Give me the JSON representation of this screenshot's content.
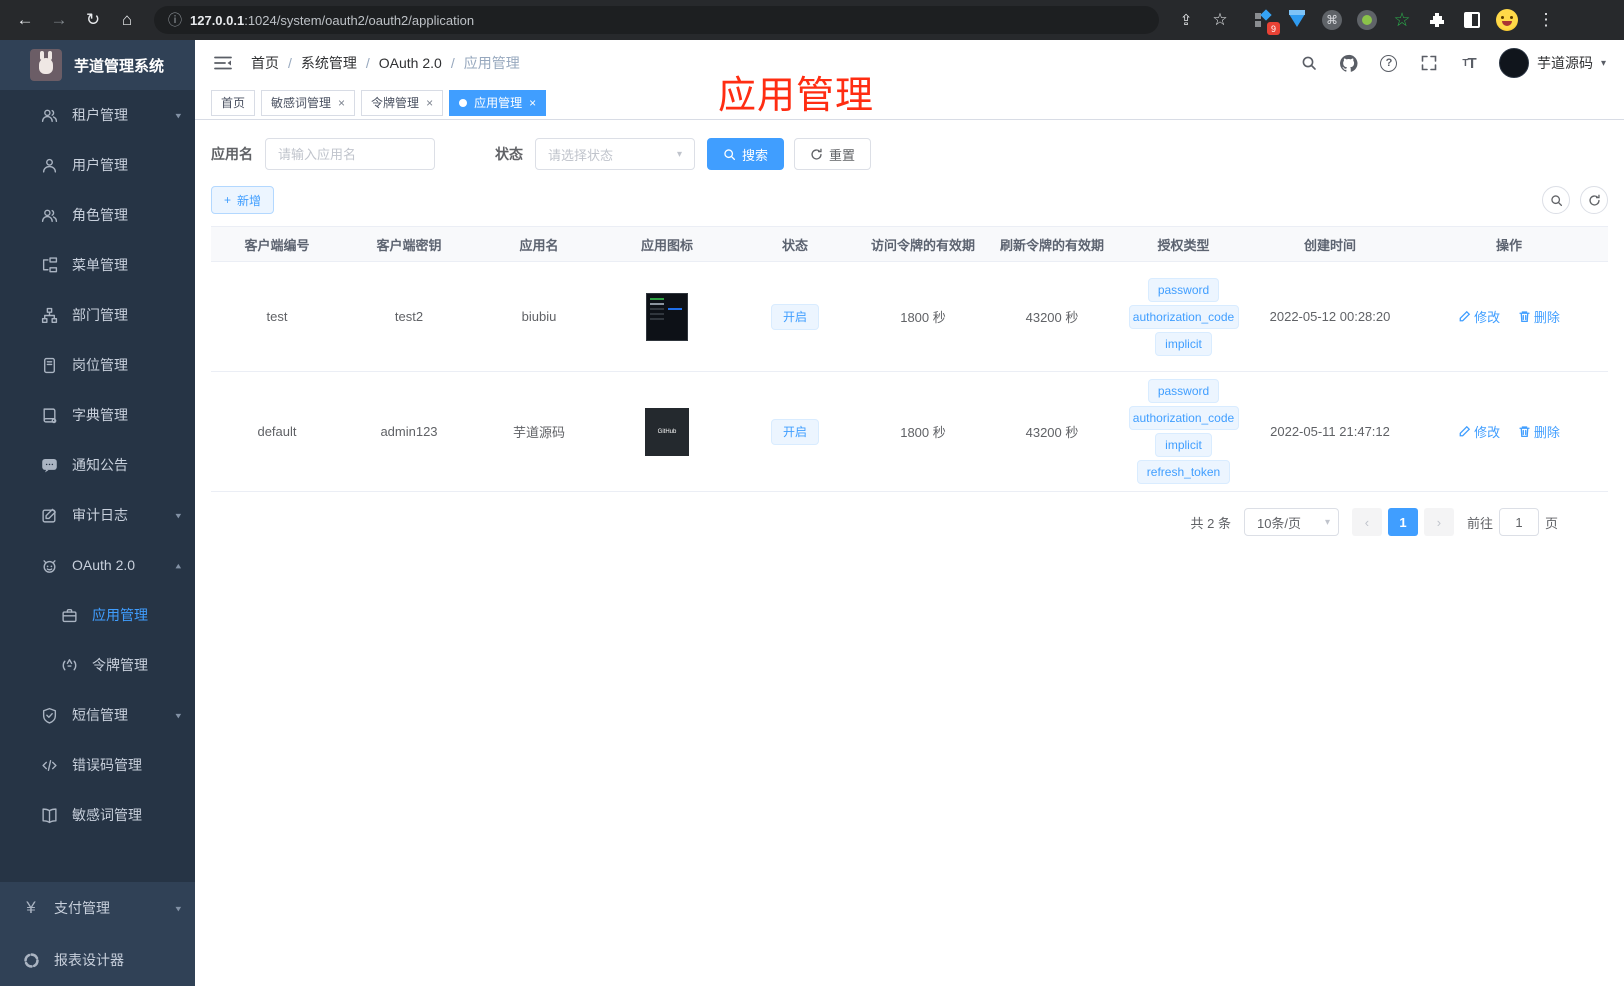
{
  "browser": {
    "url_host": "127.0.0.1",
    "url_rest": ":1024/system/oauth2/oauth2/application",
    "extension_badge": "9"
  },
  "sidebar": {
    "title": "芋道管理系统",
    "items": [
      {
        "label": "租户管理",
        "icon": "users-icon",
        "expandable": true
      },
      {
        "label": "用户管理",
        "icon": "user-icon"
      },
      {
        "label": "角色管理",
        "icon": "users-icon"
      },
      {
        "label": "菜单管理",
        "icon": "menu-tree-icon"
      },
      {
        "label": "部门管理",
        "icon": "org-chart-icon"
      },
      {
        "label": "岗位管理",
        "icon": "id-badge-icon"
      },
      {
        "label": "字典管理",
        "icon": "dictionary-icon"
      },
      {
        "label": "通知公告",
        "icon": "message-icon"
      },
      {
        "label": "审计日志",
        "icon": "audit-log-icon",
        "expandable": true
      },
      {
        "label": "OAuth 2.0",
        "icon": "robot-icon",
        "expanded": true
      },
      {
        "label": "应用管理",
        "icon": "briefcase-icon",
        "active": true
      },
      {
        "label": "令牌管理",
        "icon": "broadcast-icon"
      },
      {
        "label": "短信管理",
        "icon": "shield-icon",
        "expandable": true
      },
      {
        "label": "错误码管理",
        "icon": "code-icon"
      },
      {
        "label": "敏感词管理",
        "icon": "open-book-icon"
      },
      {
        "label": "支付管理",
        "icon": "yen-icon",
        "expandable": true
      },
      {
        "label": "报表设计器",
        "icon": "report-icon"
      }
    ]
  },
  "header": {
    "breadcrumb": [
      "首页",
      "系统管理",
      "OAuth 2.0",
      "应用管理"
    ],
    "user_name": "芋道源码"
  },
  "tabs": [
    {
      "label": "首页",
      "closable": false,
      "active": false
    },
    {
      "label": "敏感词管理",
      "closable": true,
      "active": false
    },
    {
      "label": "令牌管理",
      "closable": true,
      "active": false
    },
    {
      "label": "应用管理",
      "closable": true,
      "active": true
    }
  ],
  "annotation": {
    "text": "应用管理",
    "color": "#ff2d12"
  },
  "filters": {
    "name_label": "应用名",
    "name_placeholder": "请输入应用名",
    "status_label": "状态",
    "status_placeholder": "请选择状态",
    "search_label": "搜索",
    "reset_label": "重置"
  },
  "toolbar": {
    "add_label": "新增"
  },
  "table": {
    "columns": [
      "客户端编号",
      "客户端密钥",
      "应用名",
      "应用图标",
      "状态",
      "访问令牌的有效期",
      "刷新令牌的有效期",
      "授权类型",
      "创建时间",
      "操作"
    ],
    "rows": [
      {
        "client_id": "test",
        "secret": "test2",
        "name": "biubiu",
        "status": "开启",
        "access_validity": "1800 秒",
        "refresh_validity": "43200 秒",
        "grant_types": [
          "password",
          "authorization_code",
          "implicit"
        ],
        "create_time": "2022-05-12 00:28:20",
        "edit_label": "修改",
        "delete_label": "删除"
      },
      {
        "client_id": "default",
        "secret": "admin123",
        "name": "芋道源码",
        "icon_text": "GitHub",
        "status": "开启",
        "access_validity": "1800 秒",
        "refresh_validity": "43200 秒",
        "grant_types": [
          "password",
          "authorization_code",
          "implicit",
          "refresh_token"
        ],
        "create_time": "2022-05-11 21:47:12",
        "edit_label": "修改",
        "delete_label": "删除"
      }
    ]
  },
  "pagination": {
    "total": "共 2 条",
    "page_size": "10条/页",
    "current_page": "1",
    "goto_label": "前往",
    "goto_value": "1",
    "page_suffix": "页"
  },
  "colors": {
    "accent": "#409eff",
    "tag_bg": "#ecf5ff",
    "tag_border": "#d9ecff",
    "sidebar_bg": "#304156",
    "sidebar_submenu_bg": "#263445",
    "annotation_red": "#ff2d12"
  }
}
